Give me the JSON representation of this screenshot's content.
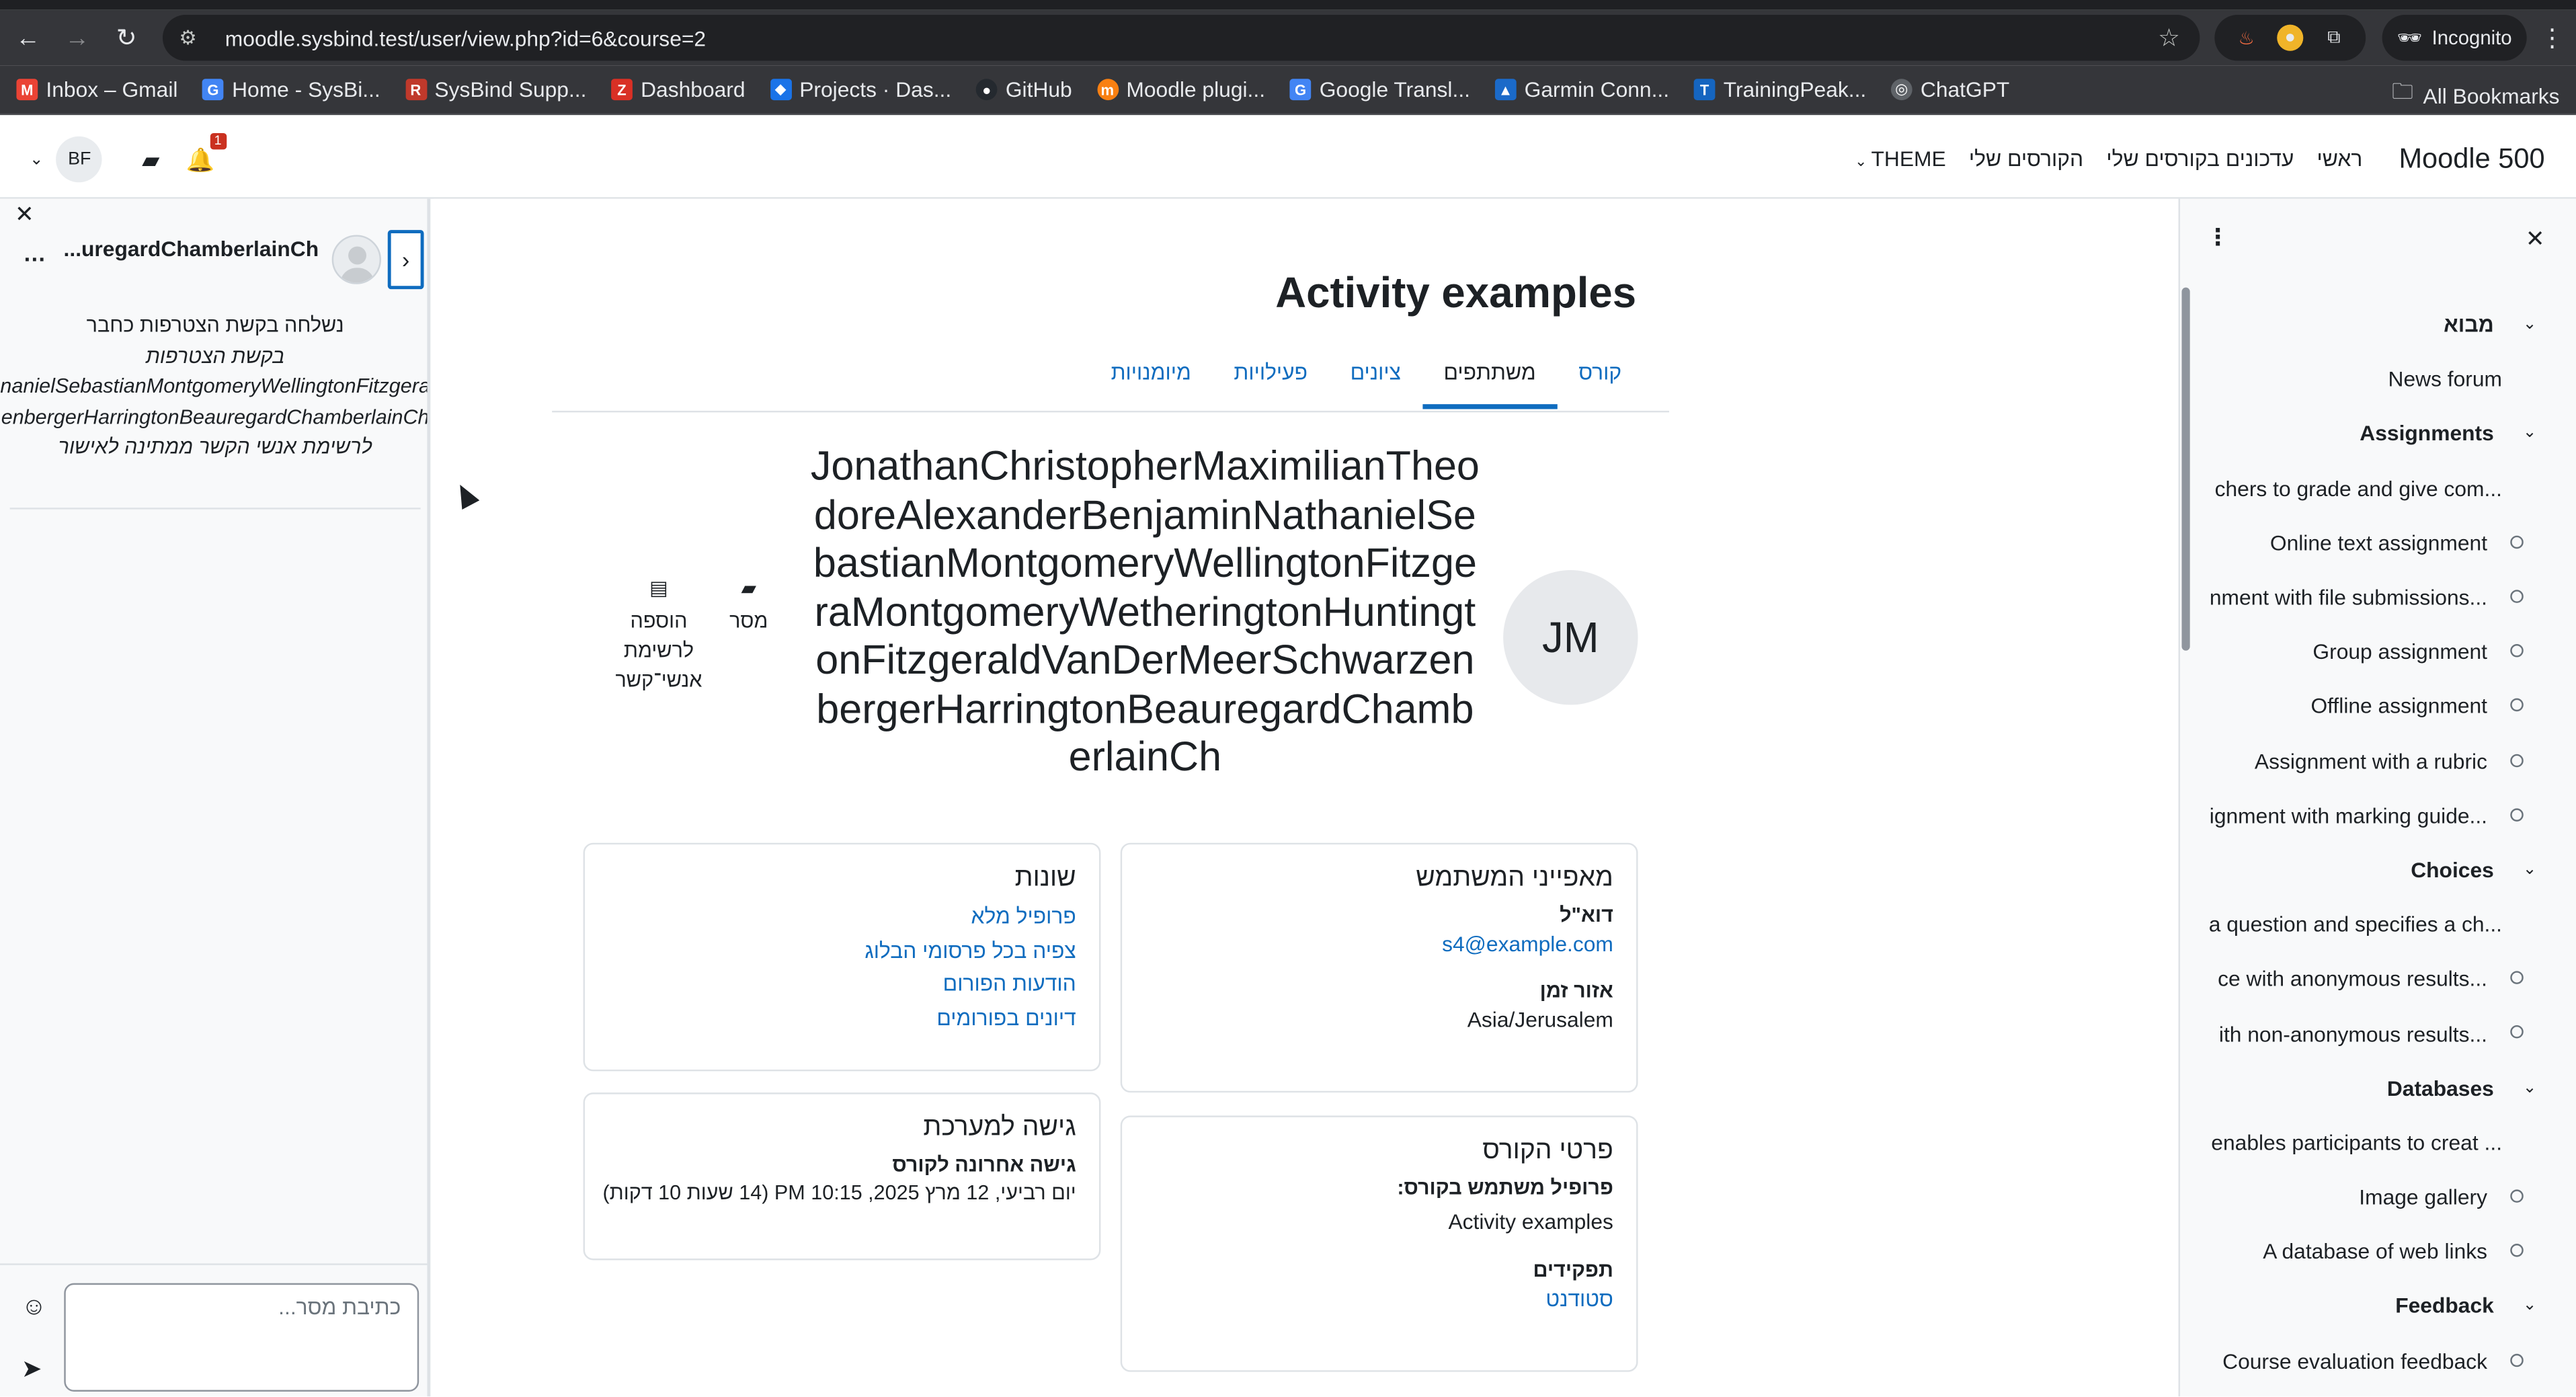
{
  "browser": {
    "url": "moodle.sysbind.test/user/view.php?id=6&course=2",
    "incognito_label": "Incognito",
    "bookmarks": [
      {
        "label": "Inbox – Gmail",
        "color": "#ea4335",
        "glyph": "M"
      },
      {
        "label": "Home - SysBi...",
        "color": "#4285f4",
        "glyph": "G"
      },
      {
        "label": "SysBind Supp...",
        "color": "#c0392b",
        "glyph": "R"
      },
      {
        "label": "Dashboard",
        "color": "#d93025",
        "glyph": "Z"
      },
      {
        "label": "Projects · Das...",
        "color": "#1a73e8",
        "glyph": "◆"
      },
      {
        "label": "GitHub",
        "color": "#24292f",
        "glyph": "●"
      },
      {
        "label": "Moodle plugi...",
        "color": "#f98012",
        "glyph": "m"
      },
      {
        "label": "Google Transl...",
        "color": "#4285f4",
        "glyph": "G"
      },
      {
        "label": "Garmin Conn...",
        "color": "#1b6ac9",
        "glyph": "▲"
      },
      {
        "label": "TrainingPeak...",
        "color": "#1565c0",
        "glyph": "T"
      },
      {
        "label": "ChatGPT",
        "color": "#5f6368",
        "glyph": "◎"
      }
    ],
    "all_bookmarks_label": "All Bookmarks"
  },
  "navbar": {
    "brand": "Moodle 500",
    "items": [
      "ראשי",
      "עדכונים בקורסים שלי",
      "הקורסים שלי",
      "THEME"
    ],
    "user_initials": "BF",
    "notification_count": "1"
  },
  "messaging": {
    "contact_name": "...uregardChamberlainCh",
    "status_line1": "נשלחה בקשת הצטרפות כחבר",
    "status_line2": "בקשת הצטרפות",
    "status_line3": "nanielSebastianMontgomeryWellingtonFitzgera",
    "status_line4": "enbergerHarringtonBeauregardChamberlainCh",
    "status_line5": "לרשימת אנשי הקשר ממתינה לאישור",
    "input_placeholder": "כתיבת מסר..."
  },
  "course": {
    "title": "Activity examples",
    "tabs": [
      "קורס",
      "משתתפים",
      "ציונים",
      "פעילויות",
      "מיומנויות"
    ],
    "active_tab": "משתתפים"
  },
  "profile": {
    "initials": "JM",
    "full_name": "JonathanChristopherMaximilianTheodoreAlexanderBenjaminNathanielSebastianMontgomeryWellingtonFitzgeraMontgomeryWetheringtonHuntingtonFitzgeraldVanDerMeerSchwarzenbergerHarringtonBeauregardChamberlainCh",
    "action_message": "מסר",
    "action_add_contact": "הוספה לרשימת אנשי־קשר"
  },
  "user_details": {
    "heading": "מאפייני המשתמש",
    "email_label": "דוא\"ל",
    "email_value": "s4@example.com",
    "timezone_label": "אזור זמן",
    "timezone_value": "Asia/Jerusalem"
  },
  "course_details": {
    "heading": "פרטי הקורס",
    "profiles_label": "פרופיל משתמש בקורס:",
    "profiles_value": "Activity examples",
    "roles_label": "תפקידים",
    "roles_value": "סטודנט"
  },
  "misc": {
    "heading": "שונות",
    "links": [
      "פרופיל מלא",
      "צפיה בכל פרסומי הבלוג",
      "הודעות הפורום",
      "דיונים בפורומים"
    ]
  },
  "access": {
    "heading": "גישה למערכת",
    "last_access_label": "גישה אחרונה לקורס",
    "last_access_value": "יום רביעי, 12 מרץ 2025, 10:15 PM  (14 שעות 10 דקות)"
  },
  "course_index": {
    "rows": [
      {
        "type": "section",
        "label": "מבוא"
      },
      {
        "type": "item",
        "label": "News forum",
        "activity": false
      },
      {
        "type": "section",
        "label": "Assignments"
      },
      {
        "type": "item",
        "label": "...chers to grade and give com",
        "activity": false
      },
      {
        "type": "item",
        "label": "Online text assignment",
        "activity": true
      },
      {
        "type": "item",
        "label": "...nment with file submissions",
        "activity": true
      },
      {
        "type": "item",
        "label": "Group assignment",
        "activity": true
      },
      {
        "type": "item",
        "label": "Offline assignment",
        "activity": true
      },
      {
        "type": "item",
        "label": "Assignment with a rubric",
        "activity": true
      },
      {
        "type": "item",
        "label": "...ignment with marking guide",
        "activity": true
      },
      {
        "type": "section",
        "label": "Choices"
      },
      {
        "type": "item",
        "label": "...a question and specifies a ch",
        "activity": false
      },
      {
        "type": "item",
        "label": "...ce with anonymous results",
        "activity": true
      },
      {
        "type": "item",
        "label": "...ith non-anonymous results",
        "activity": true
      },
      {
        "type": "section",
        "label": "Databases"
      },
      {
        "type": "item",
        "label": "... enables participants to creat",
        "activity": false
      },
      {
        "type": "item",
        "label": "Image gallery",
        "activity": true
      },
      {
        "type": "item",
        "label": "A database of web links",
        "activity": true
      },
      {
        "type": "section",
        "label": "Feedback"
      },
      {
        "type": "item",
        "label": "Course evaluation feedback",
        "activity": true
      }
    ]
  }
}
